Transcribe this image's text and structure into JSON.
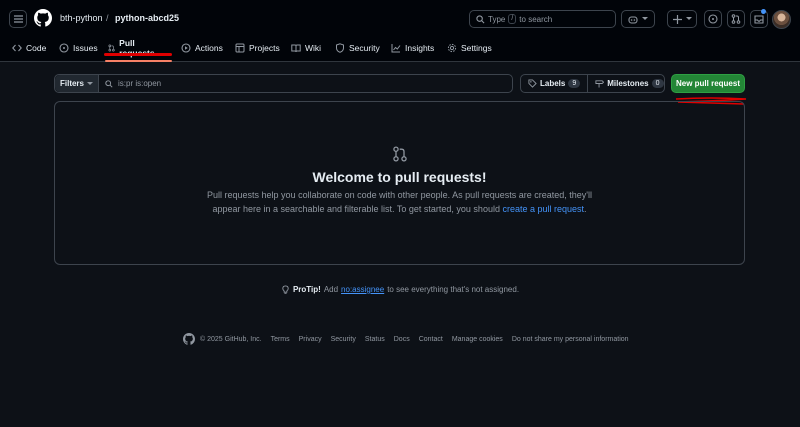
{
  "header": {
    "owner": "bth-python",
    "separator": "/",
    "repo": "python-abcd25",
    "search": {
      "before": "Type",
      "key": "/",
      "after": "to search"
    }
  },
  "tabs": [
    {
      "label": "Code",
      "icon": "code-icon"
    },
    {
      "label": "Issues",
      "icon": "issue-icon"
    },
    {
      "label": "Pull requests",
      "icon": "pull-request-icon",
      "active": true
    },
    {
      "label": "Actions",
      "icon": "play-icon"
    },
    {
      "label": "Projects",
      "icon": "table-icon"
    },
    {
      "label": "Wiki",
      "icon": "book-icon"
    },
    {
      "label": "Security",
      "icon": "shield-icon"
    },
    {
      "label": "Insights",
      "icon": "graph-icon"
    },
    {
      "label": "Settings",
      "icon": "gear-icon"
    }
  ],
  "toolbar": {
    "filters_label": "Filters",
    "query": "is:pr is:open",
    "labels_label": "Labels",
    "labels_count": "9",
    "milestones_label": "Milestones",
    "milestones_count": "0",
    "new_pr_label": "New pull request"
  },
  "blankslate": {
    "title": "Welcome to pull requests!",
    "line1": "Pull requests help you collaborate on code with other people. As pull requests are created, they'll",
    "line2": "appear here in a searchable and filterable list. To get started, you should",
    "link": "create a pull request",
    "end": "."
  },
  "protip": {
    "label": "ProTip!",
    "before": "Add",
    "link": "no:assignee",
    "after": "to see everything that's not assigned."
  },
  "footer": {
    "copyright": "© 2025 GitHub, Inc.",
    "links": [
      "Terms",
      "Privacy",
      "Security",
      "Status",
      "Docs",
      "Contact",
      "Manage cookies",
      "Do not share my personal information"
    ]
  },
  "colors": {
    "accent_green": "#238636",
    "link_blue": "#4493f8",
    "active_tab_underline": "#f78166",
    "annotation_red": "#e00000"
  }
}
